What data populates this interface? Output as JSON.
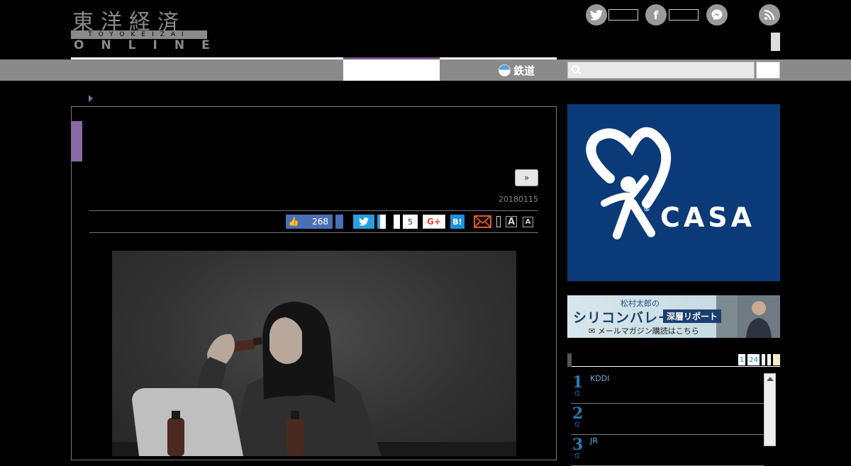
{
  "header": {
    "logo": {
      "kanji": "東洋経済",
      "romaji": "TOYOKEIZAI",
      "online": "ONLINE"
    },
    "nav": {
      "rail_label": "鉄道"
    }
  },
  "article": {
    "more_button": "»",
    "date": "20180115",
    "share": {
      "like_count": "268",
      "hatena_count": "5",
      "gplus_label": "G+",
      "hatebu_label": "B!"
    },
    "font_size_large": "A",
    "font_size_small": "A"
  },
  "ads": {
    "casa": {
      "brand": "CASA",
      "registered": "®",
      "bg_color": "#0a3a78"
    },
    "silicon_valley": {
      "author": "松村太郎の",
      "title": "シリコンバレー",
      "subtitle": "深層リポート",
      "mail_text": "メールマガジン購読はこちら"
    }
  },
  "ranking": {
    "pages": [
      "1",
      "24"
    ],
    "items": [
      {
        "num": "1",
        "suffix": "位",
        "text": "KDDI"
      },
      {
        "num": "2",
        "suffix": "位",
        "text": ""
      },
      {
        "num": "3",
        "suffix": "位",
        "text": "JR"
      }
    ]
  },
  "colors": {
    "accent_purple": "#8a6aa0",
    "link_blue": "#2a7ab8",
    "nav_gray": "#8a8a8a"
  }
}
